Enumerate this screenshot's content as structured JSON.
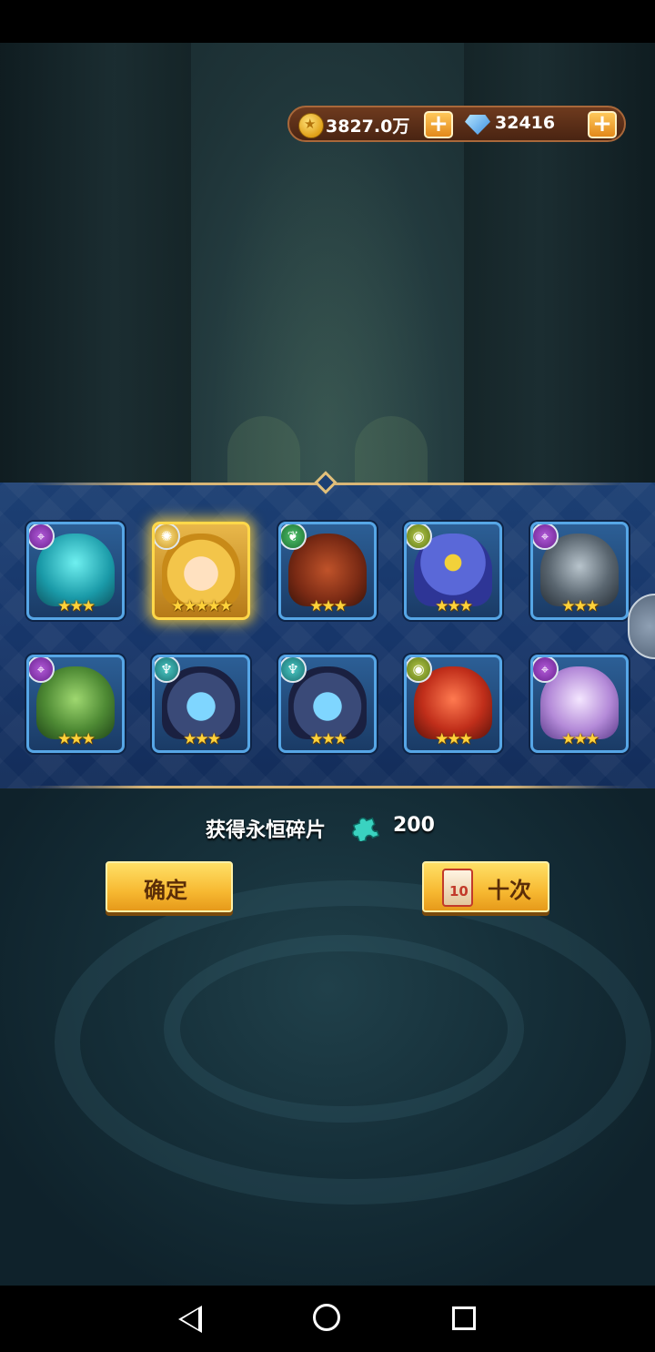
{
  "currency": {
    "gold": "3827.0万",
    "gems": "32416"
  },
  "heroes": [
    {
      "element": "purple",
      "element_icon": "location-pin-icon",
      "portrait": "cyan-beast",
      "stars": 3
    },
    {
      "element": "gold",
      "element_icon": "sun-icon",
      "portrait": "blonde-heroine",
      "stars": 5
    },
    {
      "element": "green",
      "element_icon": "leaf-icon",
      "portrait": "werewolf",
      "stars": 3
    },
    {
      "element": "olive",
      "element_icon": "eye-icon",
      "portrait": "cyclops-monster",
      "stars": 3
    },
    {
      "element": "purple",
      "element_icon": "location-pin-icon",
      "portrait": "armored-knight",
      "stars": 3
    },
    {
      "element": "purple",
      "element_icon": "location-pin-icon",
      "portrait": "dryad",
      "stars": 3
    },
    {
      "element": "teal",
      "element_icon": "tree-icon",
      "portrait": "hooded-warrior",
      "stars": 3
    },
    {
      "element": "teal",
      "element_icon": "tree-icon",
      "portrait": "hooded-warrior",
      "stars": 3
    },
    {
      "element": "olive",
      "element_icon": "eye-icon",
      "portrait": "red-ogre",
      "stars": 3
    },
    {
      "element": "purple",
      "element_icon": "location-pin-icon",
      "portrait": "ghost-girl",
      "stars": 3
    }
  ],
  "reward": {
    "label": "获得永恒碎片",
    "icon": "puzzle-piece-icon",
    "value": "200"
  },
  "buttons": {
    "confirm_label": "确定",
    "ten_times_label": "十次",
    "ten_icon_number": "10"
  },
  "colors": {
    "panel_blue": "#1c3f73",
    "card_border": "#56a6e6",
    "gold_glow": "#ffd84a",
    "button_yellow": "#f7b932"
  }
}
